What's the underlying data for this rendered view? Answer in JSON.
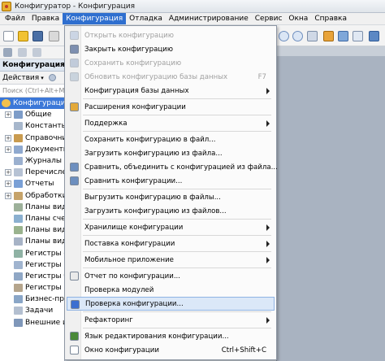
{
  "window": {
    "title": "Конфигуратор - Конфигурация"
  },
  "menubar": {
    "items": [
      "Файл",
      "Правка",
      "Конфигурация",
      "Отладка",
      "Администрирование",
      "Сервис",
      "Окна",
      "Справка"
    ]
  },
  "left_panel": {
    "header": "Конфигурация",
    "actions_label": "Действия",
    "search_placeholder": "Поиск (Ctrl+Alt+M)",
    "tree": [
      {
        "label": "Конфигурация",
        "root": true
      },
      {
        "label": "Общие",
        "expandable": true
      },
      {
        "label": "Константы",
        "expandable": false
      },
      {
        "label": "Справочники",
        "expandable": true
      },
      {
        "label": "Документы",
        "expandable": true
      },
      {
        "label": "Журналы до",
        "expandable": false
      },
      {
        "label": "Перечислени",
        "expandable": true
      },
      {
        "label": "Отчеты",
        "expandable": true
      },
      {
        "label": "Обработки",
        "expandable": true
      },
      {
        "label": "Планы видо",
        "expandable": false
      },
      {
        "label": "Планы счето",
        "expandable": false
      },
      {
        "label": "Планы видо",
        "expandable": false
      },
      {
        "label": "Планы видо",
        "expandable": false
      },
      {
        "label": "Регистры св",
        "expandable": false
      },
      {
        "label": "Регистры на",
        "expandable": false
      },
      {
        "label": "Регистры бу",
        "expandable": false
      },
      {
        "label": "Регистры ра",
        "expandable": false
      },
      {
        "label": "Бизнес-проц",
        "expandable": false
      },
      {
        "label": "Задачи",
        "expandable": false
      },
      {
        "label": "Внешние ис",
        "expandable": false
      }
    ]
  },
  "dropdown": {
    "items": [
      {
        "label": "Открыть конфигурацию",
        "disabled": true,
        "icon_color": "#9fb6d6"
      },
      {
        "label": "Закрыть конфигурацию",
        "icon_color": "#7d8fb0"
      },
      {
        "label": "Сохранить конфигурацию",
        "disabled": true,
        "icon_color": "#8aa0c0"
      },
      {
        "label": "Обновить конфигурацию базы данных",
        "shortcut": "F7",
        "disabled": true,
        "icon_color": "#9cb0c8"
      },
      {
        "label": "Конфигурация базы данных",
        "submenu": true
      },
      {
        "sep": true
      },
      {
        "label": "Расширения конфигурации",
        "icon_color": "#e3a93a"
      },
      {
        "sep": true
      },
      {
        "label": "Поддержка",
        "submenu": true
      },
      {
        "sep": true
      },
      {
        "label": "Сохранить конфигурацию в файл..."
      },
      {
        "label": "Загрузить конфигурацию из файла..."
      },
      {
        "label": "Сравнить, объединить с конфигурацией из файла...",
        "icon_color": "#6d8fbf"
      },
      {
        "label": "Сравнить конфигурации...",
        "icon_color": "#6d8fbf"
      },
      {
        "sep": true
      },
      {
        "label": "Выгрузить конфигурацию в файлы..."
      },
      {
        "label": "Загрузить конфигурацию из файлов..."
      },
      {
        "sep": true
      },
      {
        "label": "Хранилище конфигурации",
        "submenu": true
      },
      {
        "sep": true
      },
      {
        "label": "Поставка конфигурации",
        "submenu": true
      },
      {
        "sep": true
      },
      {
        "label": "Мобильное приложение",
        "submenu": true
      },
      {
        "sep": true
      },
      {
        "label": "Отчет по конфигурации...",
        "icon_color": "#eaeaea"
      },
      {
        "label": "Проверка модулей"
      },
      {
        "label": "Проверка конфигурации...",
        "highlight": true,
        "icon_color": "#3b6fd0"
      },
      {
        "sep": true
      },
      {
        "label": "Рефакторинг",
        "submenu": true
      },
      {
        "sep": true
      },
      {
        "label": "Язык редактирования конфигурации...",
        "icon_color": "#4a8a3a"
      },
      {
        "label": "Окно конфигурации",
        "shortcut": "Ctrl+Shift+C",
        "icon_color": "#ffffff"
      }
    ]
  }
}
